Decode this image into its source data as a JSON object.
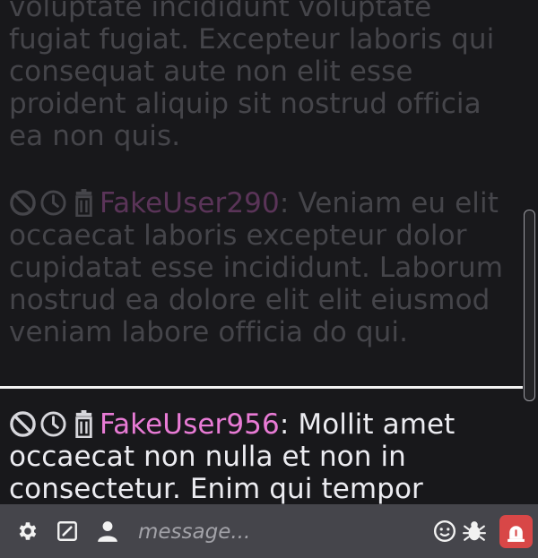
{
  "messages": [
    {
      "user": "",
      "text": "voluptate incididunt voluptate fugiat fugiat. Excepteur laboris qui consequat aute non elit esse proident aliquip sit nostrud officia ea non quis."
    },
    {
      "user": "FakeUser290",
      "text": ": Veniam eu elit occaecat laboris excepteur dolor cupidatat esse incididunt. Laborum nostrud ea dolore elit elit eiusmod veniam labore officia do qui."
    },
    {
      "user": "FakeUser956",
      "text": ": Mollit amet occaecat non nulla et non in consectetur. Enim qui tempor"
    }
  ],
  "colors": {
    "username_active": "#e87bd5",
    "username_faded": "#5a3458",
    "alert_button": "#d84747",
    "footer": "#45454b",
    "background": "#18181b"
  },
  "icons": [
    "ban-icon",
    "clock-icon",
    "trash-icon",
    "gear-icon",
    "edit-icon",
    "user-icon",
    "smiley-icon",
    "bug-icon",
    "alarm-icon"
  ],
  "composer": {
    "placeholder": "message..."
  }
}
